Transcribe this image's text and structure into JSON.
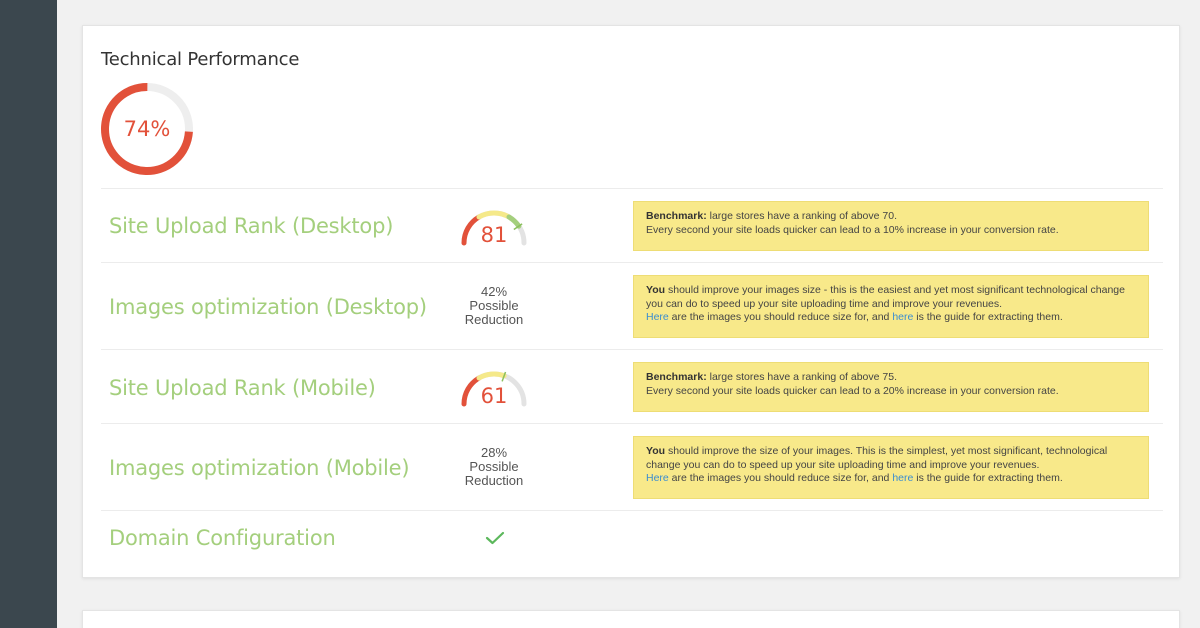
{
  "section": {
    "title": "Technical Performance",
    "score": {
      "value": 74,
      "label": "74%",
      "color": "#e2513a"
    }
  },
  "rows": [
    {
      "label": "Site Upload Rank (Desktop)",
      "gauge": {
        "value": 81,
        "label": "81"
      },
      "note": {
        "bold": "Benchmark:",
        "text1": " large stores have a ranking of above 70.",
        "line2": "Every second your site loads quicker can lead to a 10% increase in your conversion rate."
      }
    },
    {
      "label": "Images optimization (Desktop)",
      "reduction": {
        "percent": "42%",
        "line1": "Possible",
        "line2": "Reduction"
      },
      "note": {
        "bold": "You",
        "text1": " should improve your images size - this is the easiest and yet most significant technological change",
        "line2": "you can do to speed up your site uploading time and improve your revenues.",
        "link1": "Here",
        "mid": " are the images you should reduce size for, and ",
        "link2": "here",
        "end": " is the guide for extracting them."
      }
    },
    {
      "label": "Site Upload Rank (Mobile)",
      "gauge": {
        "value": 61,
        "label": "61"
      },
      "note": {
        "bold": "Benchmark:",
        "text1": " large stores have a ranking of above 75.",
        "line2": "Every second your site loads quicker can lead to a 20% increase in your conversion rate."
      }
    },
    {
      "label": "Images optimization (Mobile)",
      "reduction": {
        "percent": "28%",
        "line1": "Possible",
        "line2": "Reduction"
      },
      "note": {
        "bold": "You",
        "text1": " should improve the size of your images. This is the simplest, yet most significant, technological",
        "line2": "change you can do to speed up your site uploading time and improve your revenues.",
        "link1": "Here",
        "mid": " are the images you should reduce size for, and ",
        "link2": "here",
        "end": " is the guide for extracting them."
      }
    },
    {
      "label": "Domain Configuration",
      "status_icon": "check-icon"
    }
  ],
  "colors": {
    "sidebar": "#3b474e",
    "label_green": "#a4cf7d",
    "red": "#e2513a",
    "note_bg": "#f8e98a",
    "link": "#3a8dd0",
    "check": "#5cb85c"
  }
}
